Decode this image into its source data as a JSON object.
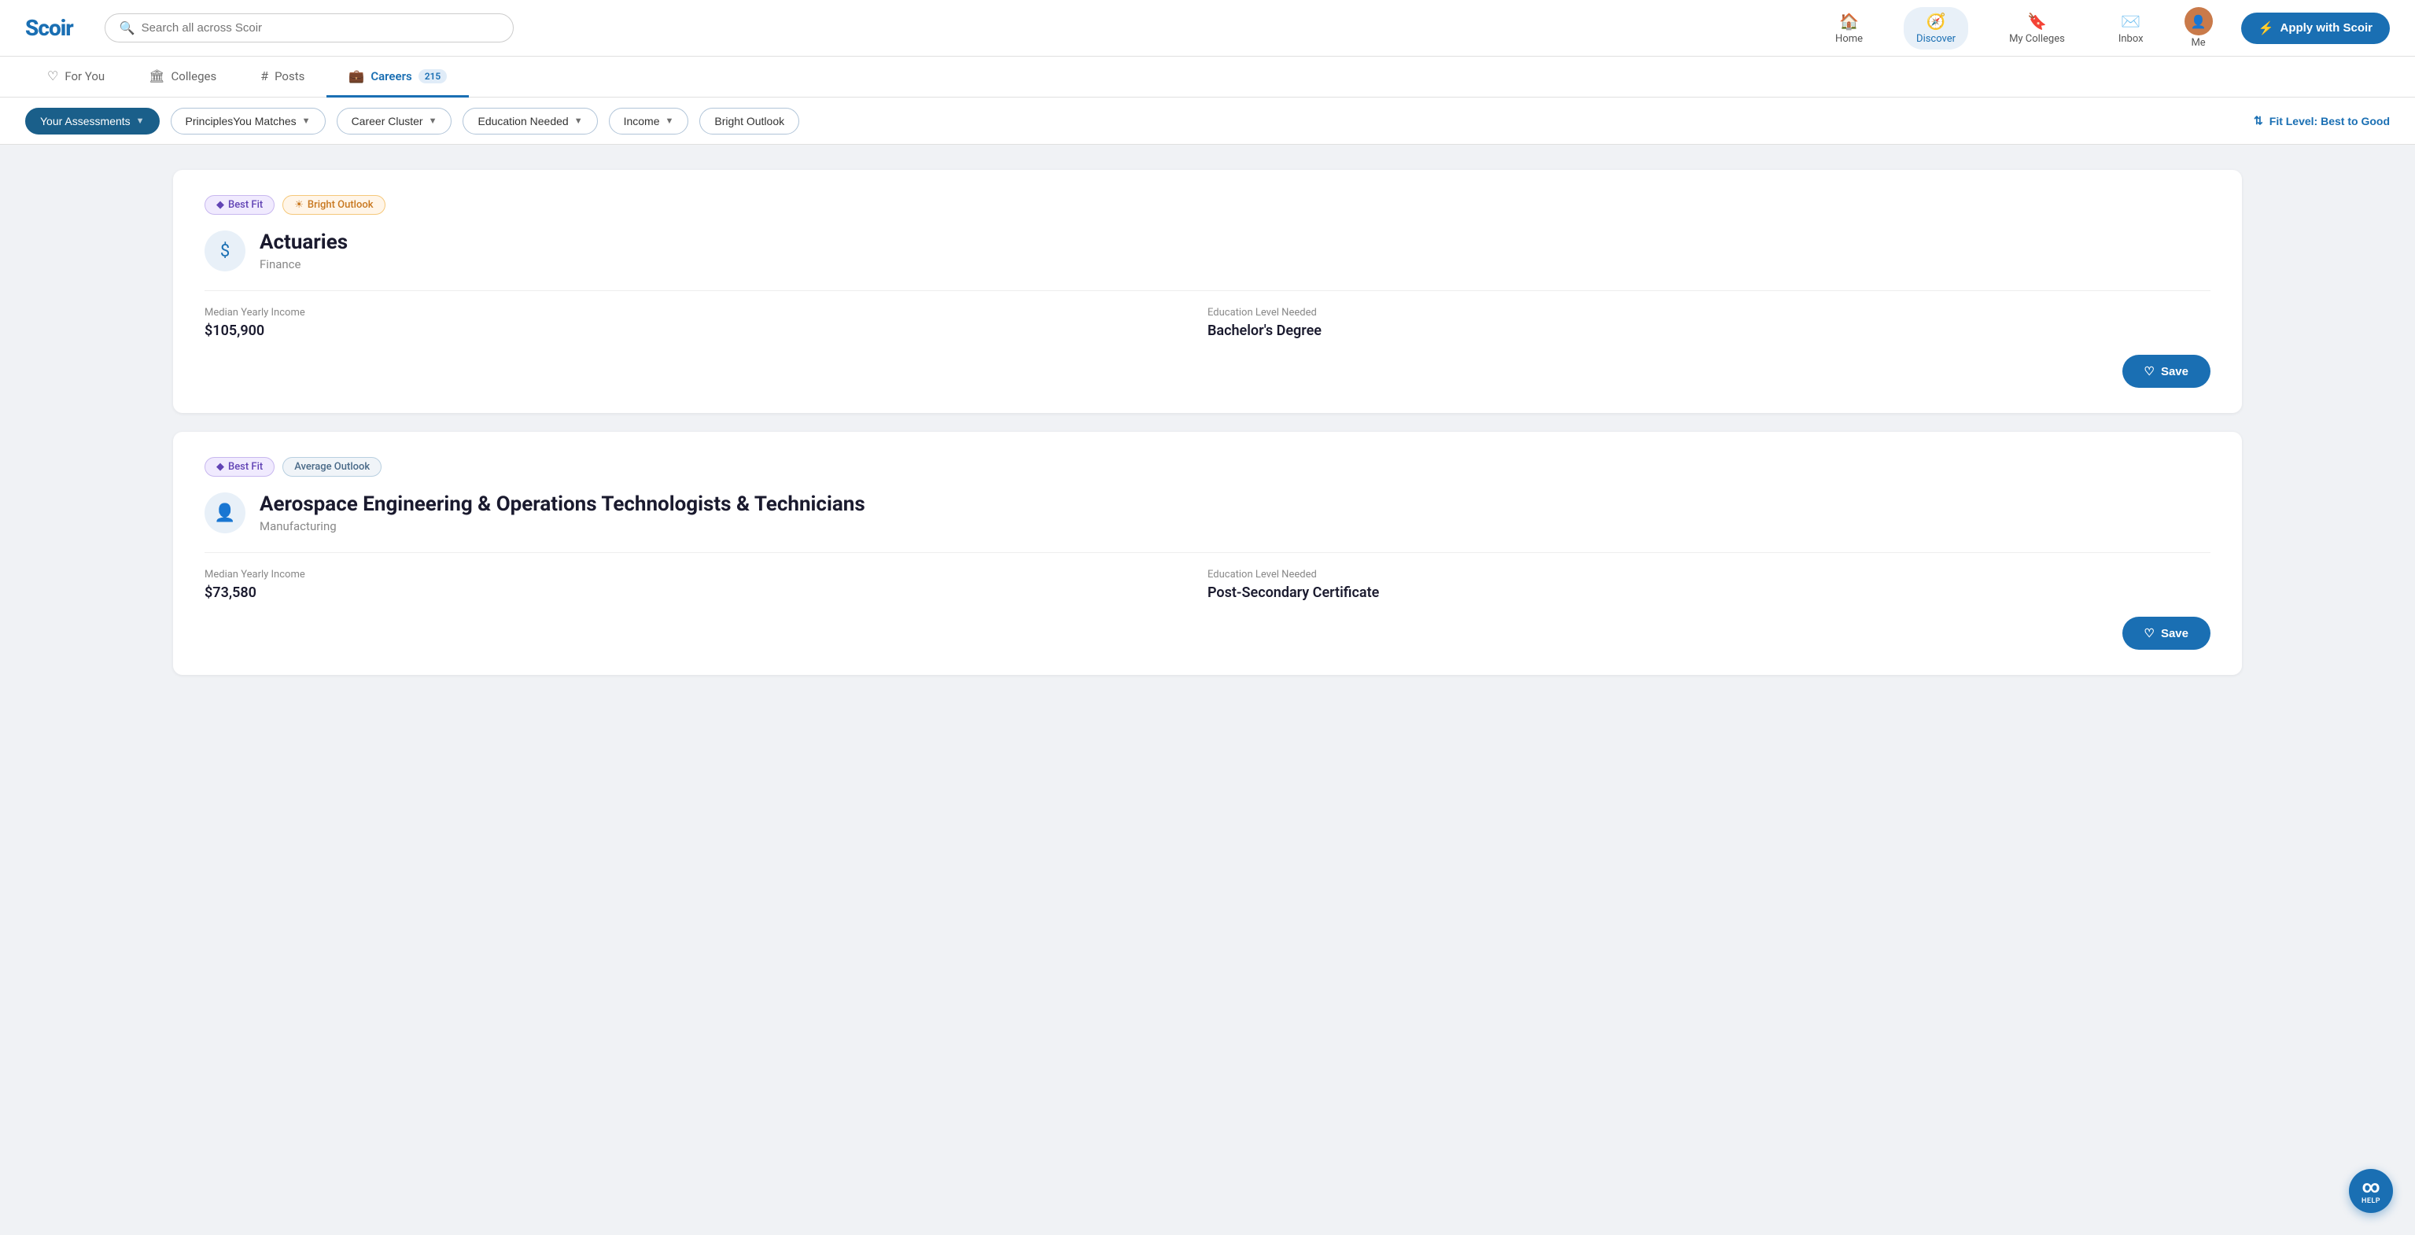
{
  "header": {
    "logo": "Scoir",
    "search_placeholder": "Search all across Scoir",
    "nav": [
      {
        "id": "home",
        "label": "Home",
        "icon": "🏠",
        "active": false
      },
      {
        "id": "discover",
        "label": "Discover",
        "icon": "🧭",
        "active": true
      },
      {
        "id": "my-colleges",
        "label": "My Colleges",
        "icon": "🔖",
        "active": false
      },
      {
        "id": "inbox",
        "label": "Inbox",
        "icon": "✉️",
        "active": false
      }
    ],
    "me_label": "Me",
    "apply_label": "Apply with Scoir"
  },
  "tabs": [
    {
      "id": "for-you",
      "label": "For You",
      "icon": "♡",
      "active": false,
      "count": null
    },
    {
      "id": "colleges",
      "label": "Colleges",
      "icon": "🏛",
      "active": false,
      "count": null
    },
    {
      "id": "posts",
      "label": "Posts",
      "icon": "#",
      "active": false,
      "count": null
    },
    {
      "id": "careers",
      "label": "Careers",
      "icon": "💼",
      "active": true,
      "count": "215"
    }
  ],
  "filters": [
    {
      "id": "assessments",
      "label": "Your Assessments",
      "primary": true
    },
    {
      "id": "principles-you",
      "label": "PrinciplesYou Matches",
      "primary": false
    },
    {
      "id": "career-cluster",
      "label": "Career Cluster",
      "primary": false
    },
    {
      "id": "education-needed",
      "label": "Education Needed",
      "primary": false
    },
    {
      "id": "income",
      "label": "Income",
      "primary": false
    },
    {
      "id": "bright-outlook",
      "label": "Bright Outlook",
      "primary": false
    }
  ],
  "fit_level_label": "Fit Level: Best to Good",
  "careers": [
    {
      "id": "actuaries",
      "title": "Actuaries",
      "cluster": "Finance",
      "icon": "$",
      "icon_type": "dollar",
      "badges": [
        {
          "type": "best-fit",
          "label": "Best Fit"
        },
        {
          "type": "bright-outlook",
          "label": "Bright Outlook"
        }
      ],
      "median_yearly_income_label": "Median Yearly Income",
      "median_yearly_income": "$105,900",
      "education_level_label": "Education Level Needed",
      "education_level": "Bachelor's Degree",
      "save_label": "Save"
    },
    {
      "id": "aerospace-engineering",
      "title": "Aerospace Engineering & Operations Technologists & Technicians",
      "cluster": "Manufacturing",
      "icon": "👤",
      "icon_type": "person",
      "badges": [
        {
          "type": "best-fit",
          "label": "Best Fit"
        },
        {
          "type": "average-outlook",
          "label": "Average Outlook"
        }
      ],
      "median_yearly_income_label": "Median Yearly Income",
      "median_yearly_income": "$73,580",
      "education_level_label": "Education Level Needed",
      "education_level": "Post-Secondary Certificate",
      "save_label": "Save"
    }
  ],
  "help": {
    "icon": "∞",
    "label": "HELP"
  }
}
